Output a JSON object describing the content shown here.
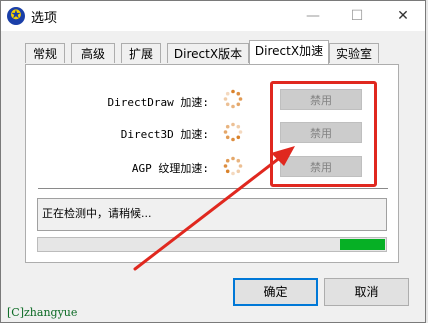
{
  "window": {
    "title": "选项",
    "app_icon": "✪",
    "minimize": "—",
    "maximize": "☐",
    "close": "✕"
  },
  "tabs": [
    {
      "label": "常规"
    },
    {
      "label": "高级"
    },
    {
      "label": "扩展"
    },
    {
      "label": "DirectX版本"
    },
    {
      "label": "DirectX加速"
    },
    {
      "label": "实验室"
    }
  ],
  "active_tab": "DirectX加速",
  "rows": [
    {
      "label": "DirectDraw 加速:",
      "button": "禁用"
    },
    {
      "label": "Direct3D 加速:",
      "button": "禁用"
    },
    {
      "label": "AGP 纹理加速:",
      "button": "禁用"
    }
  ],
  "status_text": "正在检测中，请稍候...",
  "progress": 0.13,
  "buttons": {
    "ok": "确定",
    "cancel": "取消"
  },
  "watermark": "[C]zhangyue",
  "colors": {
    "highlight": "#e0281f",
    "progress": "#06b025",
    "spinner": "#d9822b"
  }
}
